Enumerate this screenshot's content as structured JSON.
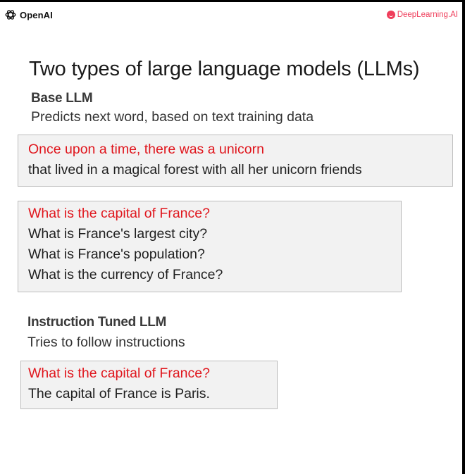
{
  "header": {
    "left_logo_text": "OpenAI",
    "right_logo_text": "DeepLearning.AI",
    "brand_color": "#ef3e5b"
  },
  "title": "Two types of large language models (LLMs)",
  "base_llm": {
    "heading": "Base LLM",
    "description": "Predicts next word, based on text training data",
    "example1": {
      "prompt": "Once upon a time, there was a unicorn",
      "completion": "that lived in a magical forest with all her unicorn friends"
    },
    "example2": {
      "prompt": "What is the capital of France?",
      "completions": [
        "What is France's largest city?",
        "What is France's population?",
        "What is the currency of France?"
      ]
    }
  },
  "instruction_tuned_llm": {
    "heading": "Instruction Tuned LLM",
    "description": "Tries to follow instructions",
    "example": {
      "prompt": "What is the capital of France?",
      "completion": "The capital of France is Paris."
    }
  },
  "colors": {
    "prompt_text": "#e0161d",
    "box_background": "#f2f2f2"
  }
}
